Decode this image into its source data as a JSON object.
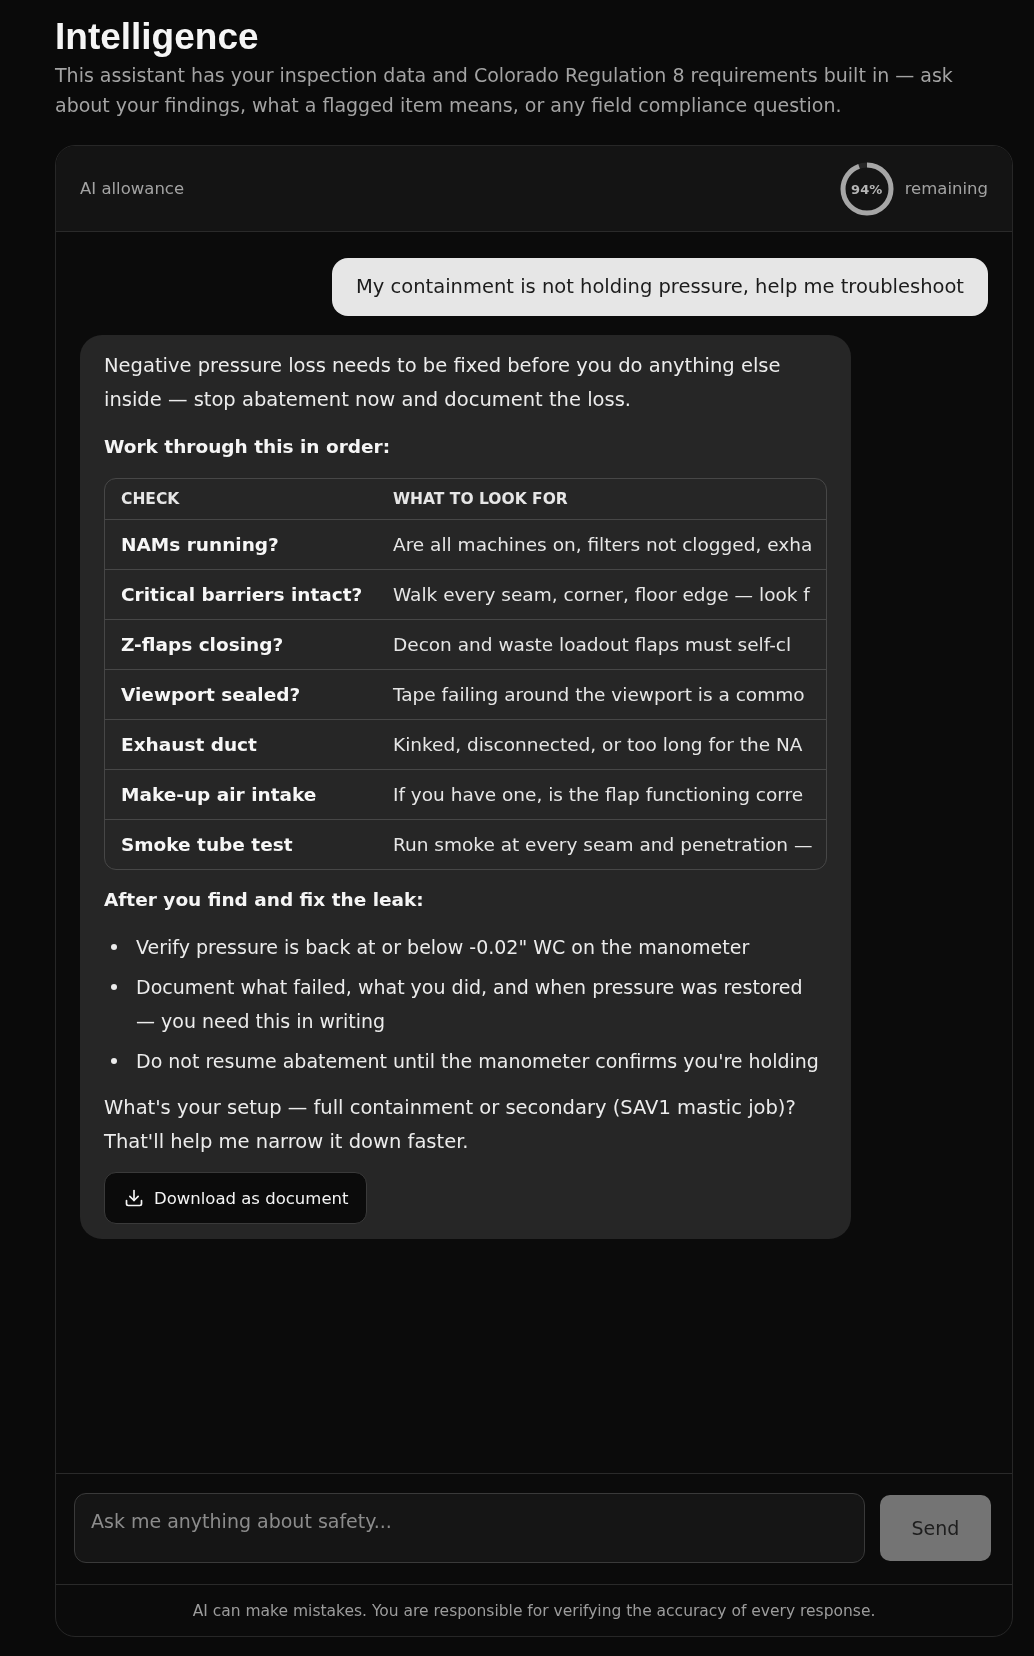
{
  "page": {
    "title": "Intelligence",
    "subtitle": "This assistant has your inspection data and Colorado Regulation 8 requirements built in — ask about your findings, what a flagged item means, or any field compliance question."
  },
  "allowance": {
    "label": "AI allowance",
    "level": 0.94,
    "value": "94%",
    "caption": "remaining"
  },
  "messages": [
    {
      "kind": "user",
      "text": "My containment is not holding pressure, help me troubleshoot"
    },
    {
      "kind": "assistant",
      "blocks": [
        {
          "kind": "paragraph",
          "text": "Negative pressure loss needs to be fixed before you do anything else inside — stop abatement now and document the loss."
        },
        {
          "kind": "heading",
          "text": "Work through this in order:"
        },
        {
          "kind": "table",
          "columns": [
            "CHECK",
            "WHAT TO LOOK FOR"
          ],
          "rows": [
            [
              "NAMs running?",
              "Are all machines on, filters not clogged, exha"
            ],
            [
              "Critical barriers intact?",
              "Walk every seam, corner, floor edge — look f"
            ],
            [
              "Z-flaps closing?",
              "Decon and waste loadout flaps must self-cl"
            ],
            [
              "Viewport sealed?",
              "Tape failing around the viewport is a commo"
            ],
            [
              "Exhaust duct",
              "Kinked, disconnected, or too long for the NA"
            ],
            [
              "Make-up air intake",
              "If you have one, is the flap functioning corre"
            ],
            [
              "Smoke tube test",
              "Run smoke at every seam and penetration —"
            ]
          ]
        },
        {
          "kind": "heading",
          "text": "After you find and fix the leak:"
        },
        {
          "kind": "list",
          "items": [
            "Verify pressure is back at or below -0.02\" WC on the manometer",
            "Document what failed, what you did, and when pressure was restored — you need this in writing",
            "Do not resume abatement until the manometer confirms you're holding"
          ]
        },
        {
          "kind": "paragraph",
          "text": "What's your setup — full containment or secondary (SAV1 mastic job)? That'll help me narrow it down faster."
        },
        {
          "kind": "download",
          "label": "Download as document"
        }
      ]
    }
  ],
  "composer": {
    "placeholder": "Ask me anything about safety...",
    "send": {
      "label": "Send",
      "disabled": true
    }
  },
  "disclaimer": "AI can make mistakes. You are responsible for verifying the accuracy of every response."
}
